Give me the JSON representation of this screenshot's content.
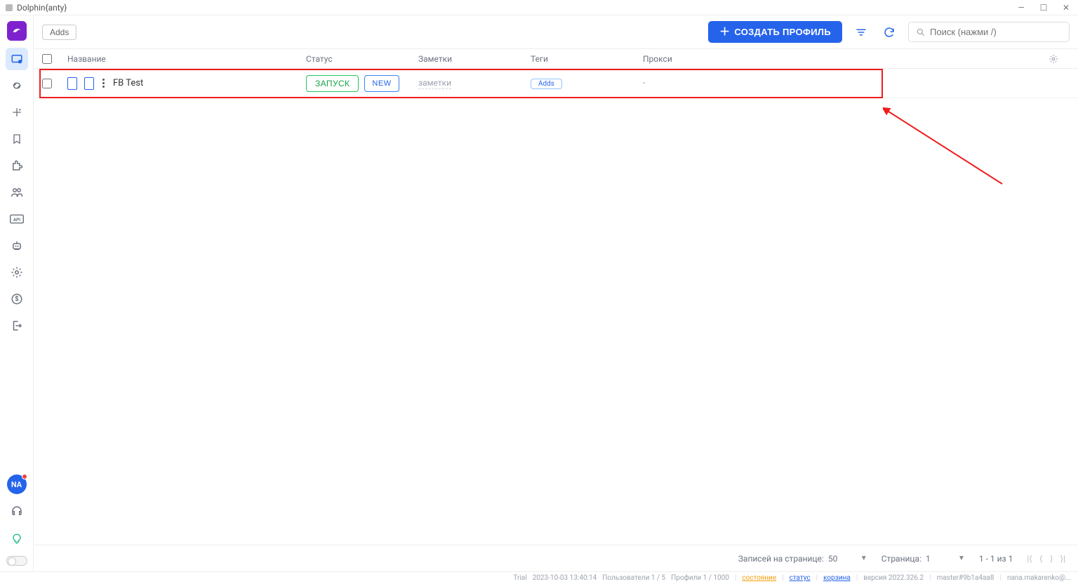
{
  "window": {
    "title": "Dolphin{anty}"
  },
  "toolbar": {
    "adds_label": "Adds",
    "create_label": "СОЗДАТЬ ПРОФИЛЬ",
    "search_placeholder": "Поиск (нажми /)"
  },
  "avatar": {
    "initials": "NA"
  },
  "columns": {
    "name": "Название",
    "status": "Статус",
    "notes": "Заметки",
    "tags": "Теги",
    "proxy": "Прокси"
  },
  "rows": [
    {
      "name": "FB Test",
      "launch_label": "ЗАПУСК",
      "status_badge": "NEW",
      "notes_placeholder": "заметки",
      "tags_label": "Adds",
      "proxy": "-"
    }
  ],
  "pager": {
    "per_page_label": "Записей на странице:",
    "per_page_value": "50",
    "page_label": "Страница:",
    "page_value": "1",
    "range_label": "1 - 1 из 1"
  },
  "statusbar": {
    "trial": "Trial",
    "datetime": "2023-10-03 13:40:14",
    "users": "Пользователи 1 / 5",
    "profiles": "Профили 1 / 1000",
    "link_state": "состояние",
    "link_status": "статус",
    "link_trash": "корзина",
    "version": "версия 2022.326.2",
    "build": "master#9b1a4aa8",
    "email": "nana.makarenko@..."
  }
}
